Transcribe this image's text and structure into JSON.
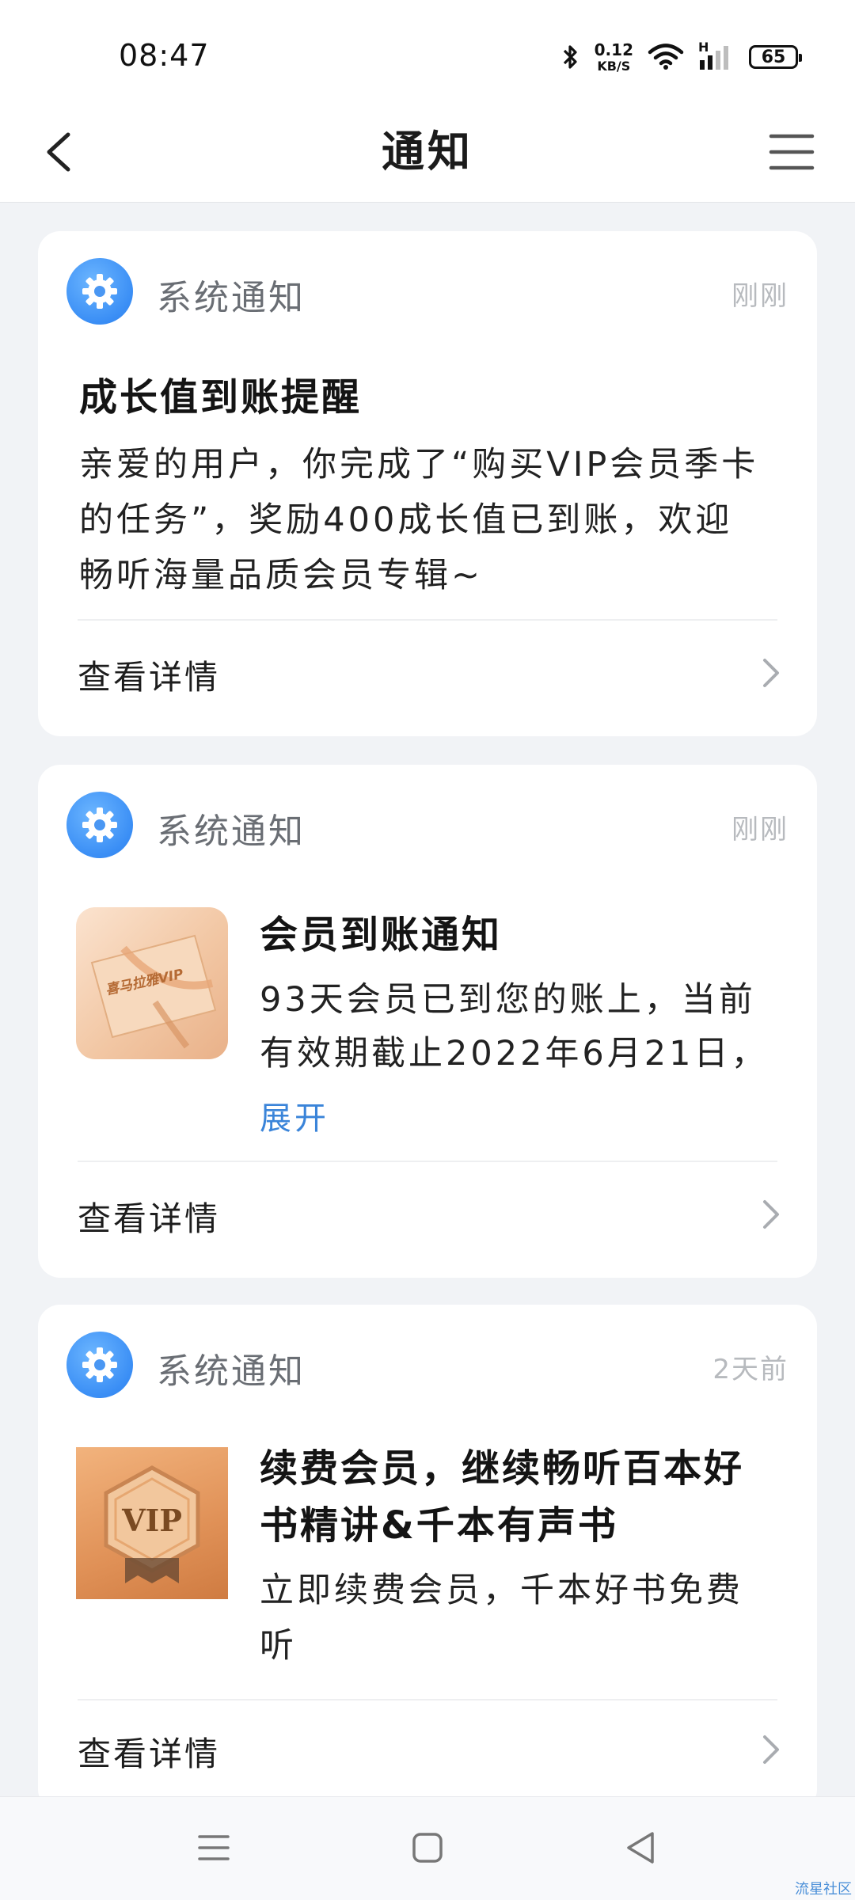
{
  "status_bar": {
    "time": "08:47",
    "net_speed_value": "0.12",
    "net_speed_unit": "KB/S",
    "network_type": "H",
    "battery": "65"
  },
  "header": {
    "title": "通知"
  },
  "cards": [
    {
      "type": "系统通知",
      "time": "刚刚",
      "title": "成长值到账提醒",
      "body": [
        "亲爱的用户，你完成了“购买VIP会员季卡",
        "的任务”，奖励400成长值已到账，欢迎",
        "畅听海量品质会员专辑~"
      ],
      "detail_label": "查看详情"
    },
    {
      "type": "系统通知",
      "time": "刚刚",
      "title": "会员到账通知",
      "body": [
        "93天会员已到您的账上，当前",
        "有效期截止2022年6月21日，"
      ],
      "expand_label": "展开",
      "thumb_text": "喜马拉雅VIP",
      "detail_label": "查看详情"
    },
    {
      "type": "系统通知",
      "time": "2天前",
      "title": [
        "续费会员，继续畅听百本好",
        "书精讲&千本有声书"
      ],
      "body": [
        "立即续费会员，千本好书免费",
        "听"
      ],
      "thumb_text": "VIP",
      "detail_label": "查看详情"
    }
  ],
  "watermark": "流星社区",
  "colors": {
    "accent_blue": "#3a8ef5",
    "link_blue": "#3a84d9",
    "background": "#f1f3f6"
  }
}
